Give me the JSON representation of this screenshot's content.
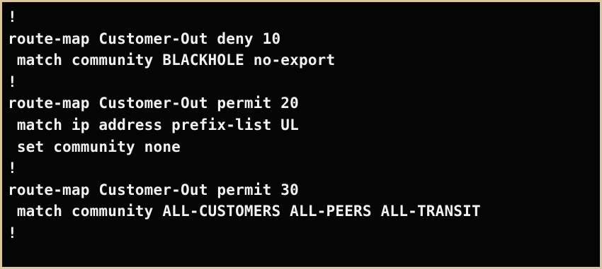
{
  "terminal": {
    "lines": [
      "!",
      "route-map Customer-Out deny 10",
      " match community BLACKHOLE no-export",
      "!",
      "route-map Customer-Out permit 20",
      " match ip address prefix-list UL",
      " set community none",
      "!",
      "route-map Customer-Out permit 30",
      " match community ALL-CUSTOMERS ALL-PEERS ALL-TRANSIT",
      "!"
    ],
    "colors": {
      "background": "#050505",
      "text": "#f2f2f2",
      "frame": "#d9c7a0"
    }
  }
}
